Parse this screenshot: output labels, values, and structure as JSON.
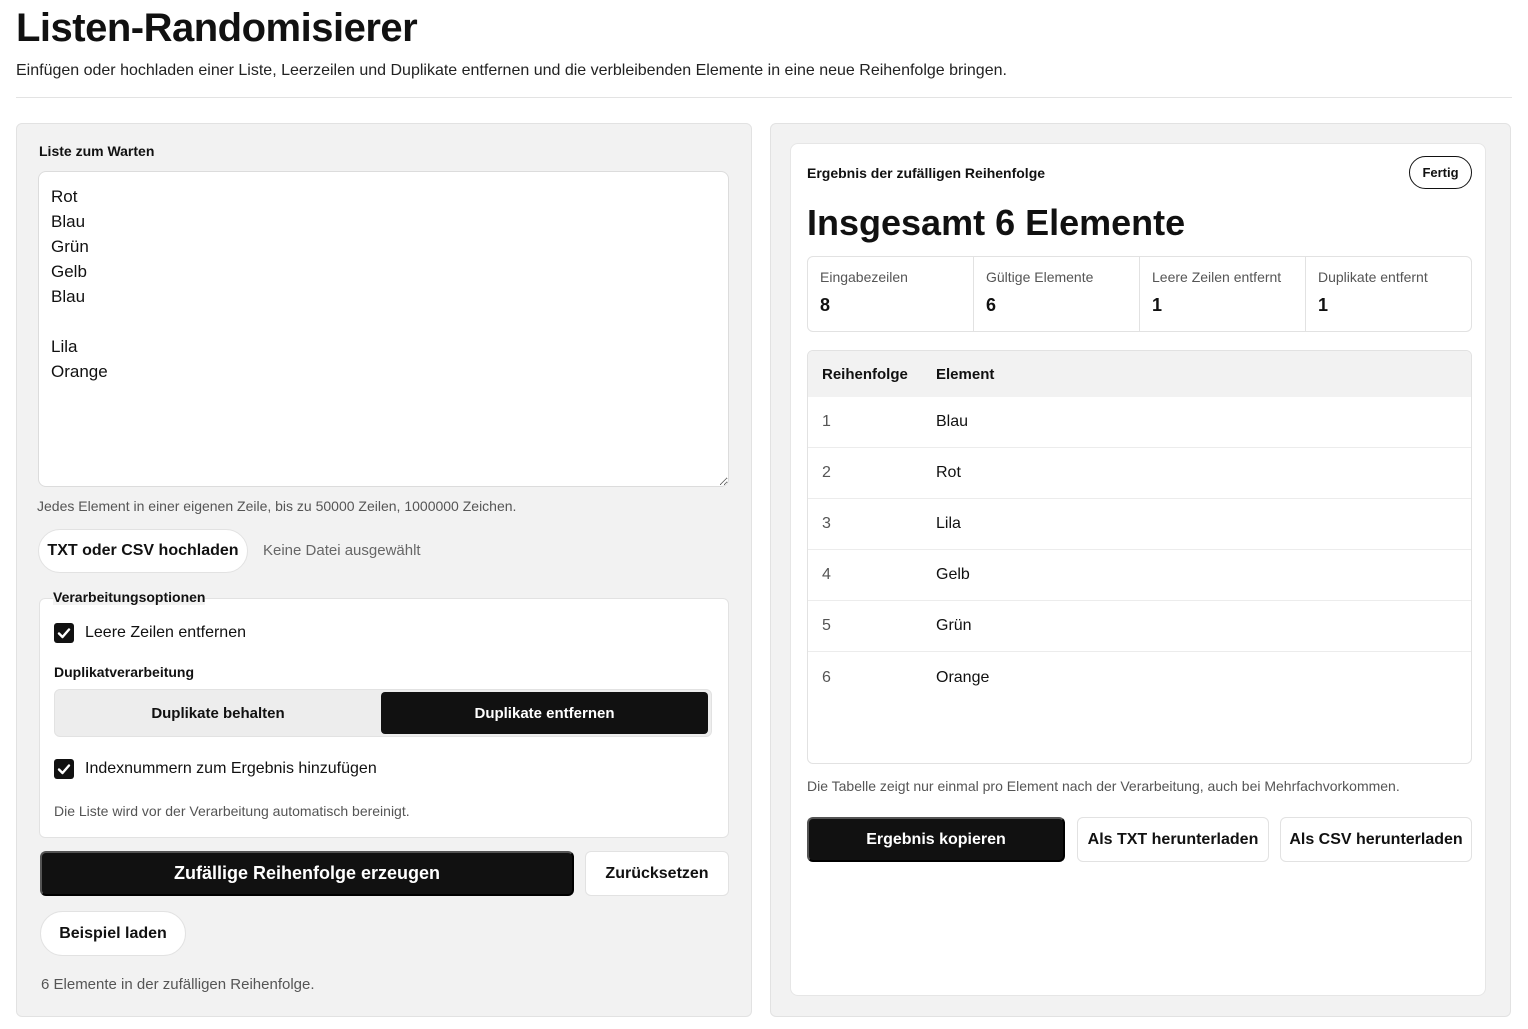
{
  "header": {
    "title": "Listen-Randomisierer",
    "subtitle": "Einfügen oder hochladen einer Liste, Leerzeilen und Duplikate entfernen und die verbleibenden Elemente in eine neue Reihenfolge bringen."
  },
  "input_panel": {
    "list_label": "Liste zum Warten",
    "list_value": "Rot\nBlau\nGrün\nGelb\nBlau\n\nLila\nOrange",
    "list_hint": "Jedes Element in einer eigenen Zeile, bis zu 50000 Zeilen, 1000000 Zeichen.",
    "upload_button": "TXT oder CSV hochladen",
    "upload_status": "Keine Datei ausgewählt",
    "options": {
      "legend": "Verarbeitungsoptionen",
      "remove_empty_label": "Leere Zeilen entfernen",
      "remove_empty_checked": true,
      "duplicate_heading": "Duplikatverarbeitung",
      "duplicate_keep": "Duplikate behalten",
      "duplicate_remove": "Duplikate entfernen",
      "duplicate_selected": "Duplikate entfernen",
      "index_label": "Indexnummern zum Ergebnis hinzufügen",
      "index_checked": true,
      "auto_clean_note": "Die Liste wird vor der Verarbeitung automatisch bereinigt."
    },
    "generate_button": "Zufällige Reihenfolge erzeugen",
    "reset_button": "Zurücksetzen",
    "example_button": "Beispiel laden",
    "status_text": "6 Elemente in der zufälligen Reihenfolge."
  },
  "result_panel": {
    "heading": "Ergebnis der zufälligen Reihenfolge",
    "status_badge": "Fertig",
    "total_title": "Insgesamt 6 Elemente",
    "stats": [
      {
        "label": "Eingabezeilen",
        "value": "8"
      },
      {
        "label": "Gültige Elemente",
        "value": "6"
      },
      {
        "label": "Leere Zeilen entfernt",
        "value": "1"
      },
      {
        "label": "Duplikate entfernt",
        "value": "1"
      }
    ],
    "table": {
      "headers": [
        "Reihenfolge",
        "Element"
      ],
      "rows": [
        [
          "1",
          "Blau"
        ],
        [
          "2",
          "Rot"
        ],
        [
          "3",
          "Lila"
        ],
        [
          "4",
          "Gelb"
        ],
        [
          "5",
          "Grün"
        ],
        [
          "6",
          "Orange"
        ]
      ]
    },
    "table_note": "Die Tabelle zeigt nur einmal pro Element nach der Verarbeitung, auch bei Mehrfachvorkommen.",
    "copy_button": "Ergebnis kopieren",
    "txt_button": "Als TXT herunterladen",
    "csv_button": "Als CSV herunterladen"
  },
  "colors": {
    "primary": "#111111",
    "panel_bg": "#f2f2f2",
    "border": "#e2e2e2"
  },
  "icons": {
    "checkbox": "check-icon"
  }
}
